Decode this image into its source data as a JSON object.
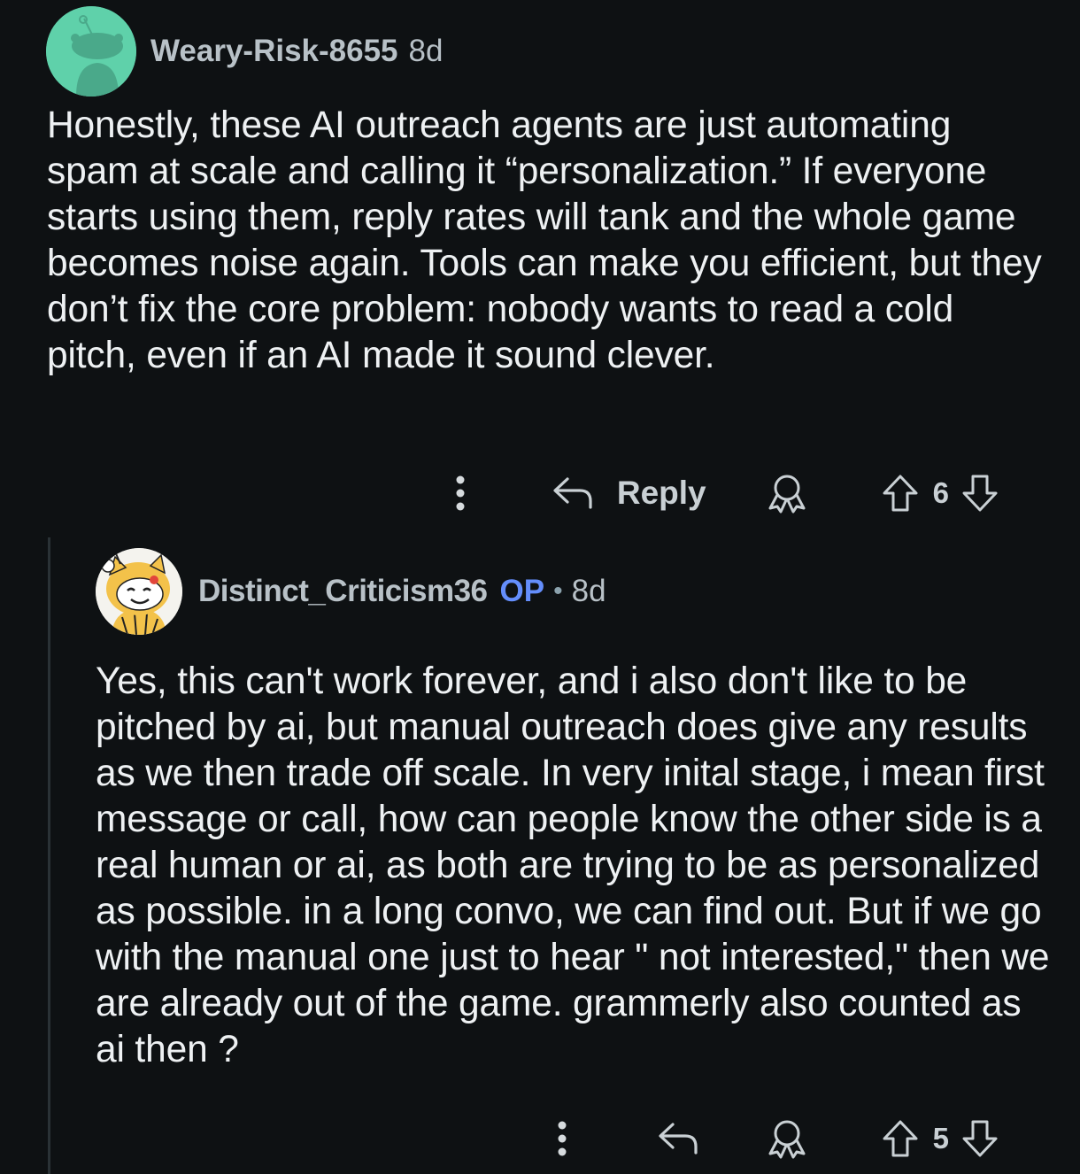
{
  "comments": [
    {
      "username": "Weary-Risk-8655",
      "age": "8d",
      "body": "Honestly, these AI outreach agents are just automating spam at scale and calling it “personalization.” If everyone starts using them, reply rates will tank and the whole game becomes noise again. Tools can make you efficient, but they don’t fix the core problem: nobody wants to read a cold pitch, even if an AI made it sound clever.",
      "reply_label": "Reply",
      "score": "6"
    },
    {
      "username": "Distinct_Criticism36",
      "op_badge": "OP",
      "separator": "•",
      "age": "8d",
      "body": "Yes, this can't work forever, and i also don't like to be pitched by ai, but manual outreach does give any results as we then trade off scale. In very inital stage, i mean first message or call, how can people know the other side is a real human or ai, as both are trying to be as personalized as possible. in a long convo, we can find out. But if we go with the manual one just to hear \" not interested,\" then we are already out of the game. grammerly also counted as ai then ?",
      "score": "5"
    }
  ],
  "icons": {
    "more": "more-vertical-icon",
    "reply": "reply-arrow-icon",
    "award": "award-icon",
    "upvote": "upvote-arrow-icon",
    "downvote": "downvote-arrow-icon"
  },
  "colors": {
    "background": "#0e1113",
    "op_badge": "#648efc",
    "avatar_1": "#5fd1aa"
  }
}
